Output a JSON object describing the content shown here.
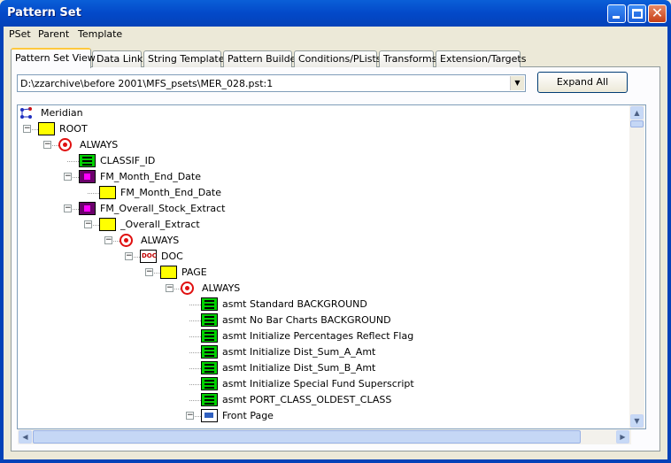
{
  "window": {
    "title": "Pattern Set"
  },
  "menu": [
    "PSet",
    "Parent",
    "Template"
  ],
  "tabs": [
    "Pattern Set View",
    "Data Link",
    "String Templates",
    "Pattern Builder",
    "Conditions/PLists",
    "Transforms",
    "Extension/Targets"
  ],
  "path_combo": {
    "value": "D:\\zzarchive\\before 2001\\MFS_psets\\MER_028.pst:1"
  },
  "expand_all_label": "Expand All",
  "tree": [
    {
      "label": "Meridian",
      "icon": "meridian-icon",
      "level": 0,
      "expander": false
    },
    {
      "label": "ROOT",
      "icon": "folder-icon",
      "level": 0,
      "expander": true
    },
    {
      "label": "ALWAYS",
      "icon": "target-icon",
      "level": 1,
      "expander": true
    },
    {
      "label": "CLASSIF_ID",
      "icon": "list-icon",
      "level": 2,
      "expander": false
    },
    {
      "label": "FM_Month_End_Date",
      "icon": "magenta-box-icon",
      "level": 2,
      "expander": true
    },
    {
      "label": "FM_Month_End_Date",
      "icon": "folder-icon",
      "level": 3,
      "expander": false
    },
    {
      "label": "FM_Overall_Stock_Extract",
      "icon": "magenta-box-icon",
      "level": 2,
      "expander": true
    },
    {
      "label": "_Overall_Extract",
      "icon": "folder-icon",
      "level": 3,
      "expander": true
    },
    {
      "label": "ALWAYS",
      "icon": "target-icon",
      "level": 4,
      "expander": true
    },
    {
      "label": "DOC",
      "icon": "doc-icon",
      "level": 5,
      "expander": true
    },
    {
      "label": "PAGE",
      "icon": "folder-icon",
      "level": 6,
      "expander": true
    },
    {
      "label": "ALWAYS",
      "icon": "target-icon",
      "level": 7,
      "expander": true
    },
    {
      "label": "asmt Standard BACKGROUND",
      "icon": "list-icon",
      "level": 8,
      "expander": false
    },
    {
      "label": "asmt No Bar Charts BACKGROUND",
      "icon": "list-icon",
      "level": 8,
      "expander": false
    },
    {
      "label": "asmt Initialize Percentages Reflect Flag",
      "icon": "list-icon",
      "level": 8,
      "expander": false
    },
    {
      "label": "asmt Initialize Dist_Sum_A_Amt",
      "icon": "list-icon",
      "level": 8,
      "expander": false
    },
    {
      "label": "asmt Initialize Dist_Sum_B_Amt",
      "icon": "list-icon",
      "level": 8,
      "expander": false
    },
    {
      "label": "asmt Initialize Special Fund Superscript",
      "icon": "list-icon",
      "level": 8,
      "expander": false
    },
    {
      "label": "asmt PORT_CLASS_OLDEST_CLASS",
      "icon": "list-icon",
      "level": 8,
      "expander": false
    },
    {
      "label": "Front Page",
      "icon": "page-icon",
      "level": 8,
      "expander": true
    }
  ]
}
